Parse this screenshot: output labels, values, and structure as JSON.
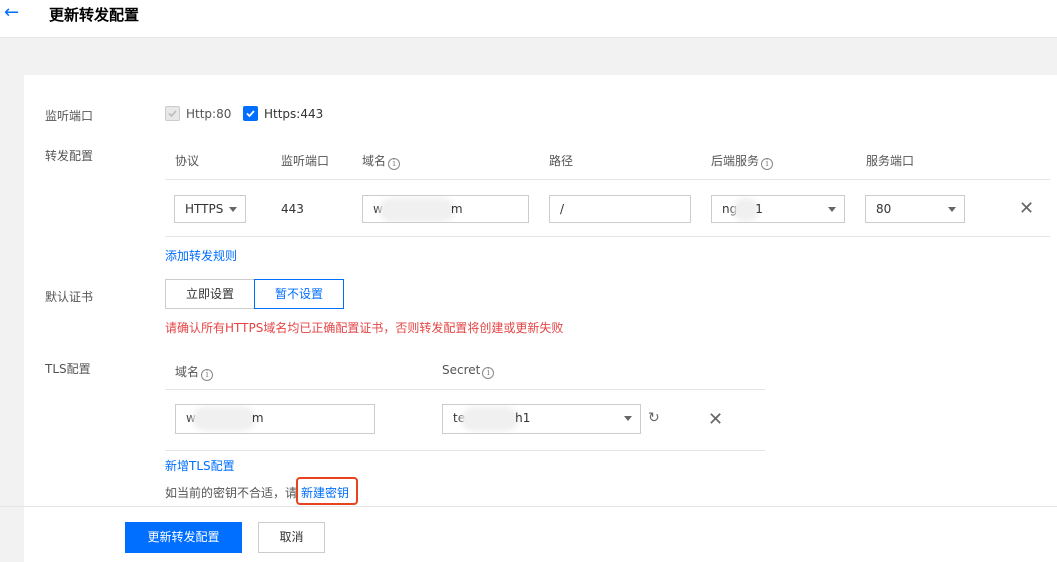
{
  "header": {
    "title": "更新转发配置",
    "back_icon": "arrow-left-icon"
  },
  "listen_port": {
    "label": "监听端口",
    "options": [
      {
        "label": "Http:80",
        "checked": true,
        "disabled": true
      },
      {
        "label": "Https:443",
        "checked": true,
        "disabled": false
      }
    ]
  },
  "forward_config": {
    "label": "转发配置",
    "columns": [
      "协议",
      "监听端口",
      "域名",
      "路径",
      "后端服务",
      "服务端口"
    ],
    "row": {
      "protocol": "HTTPS",
      "port": "443",
      "domain_start": "w",
      "domain_end": "m",
      "path": "/",
      "backend_start": "ng",
      "backend_end": "1",
      "service_port": "80"
    },
    "add_rule": "添加转发规则"
  },
  "default_cert": {
    "label": "默认证书",
    "buttons": [
      "立即设置",
      "暂不设置"
    ],
    "selected": "暂不设置",
    "warning": "请确认所有HTTPS域名均已正确配置证书，否则转发配置将创建或更新失败"
  },
  "tls_config": {
    "label": "TLS配置",
    "columns": [
      "域名",
      "Secret"
    ],
    "row": {
      "domain_start": "w",
      "domain_end": "m",
      "secret_start": "te",
      "secret_end": "h1"
    },
    "add_tls": "新增TLS配置",
    "hint": "如当前的密钥不合适，请",
    "new_key": "新建密钥"
  },
  "footer": {
    "submit": "更新转发配置",
    "cancel": "取消"
  },
  "colors": {
    "accent": "#006eff",
    "warning": "#e54545",
    "highlight": "#e8431f"
  }
}
